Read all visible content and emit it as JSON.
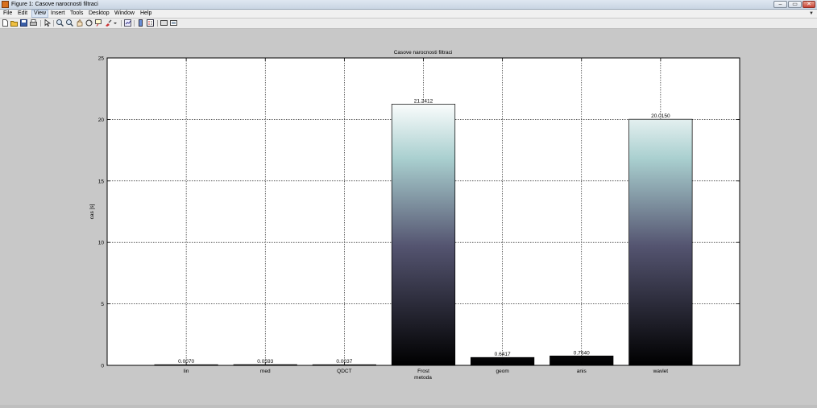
{
  "window": {
    "title": "Figure 1: Casove narocnosti filtraci",
    "controls": {
      "minimize": "–",
      "maximize": "▭",
      "close": "✕"
    }
  },
  "menu": [
    "File",
    "Edit",
    "View",
    "Insert",
    "Tools",
    "Desktop",
    "Window",
    "Help"
  ],
  "menu_active": "View",
  "toolbar": {
    "icons": [
      "new-figure-icon",
      "open-file-icon",
      "save-icon",
      "print-icon",
      "edit-plot-arrow-icon",
      "zoom-in-icon",
      "zoom-out-icon",
      "pan-hand-icon",
      "rotate-3d-icon",
      "data-cursor-icon",
      "brush-icon",
      "brush-dropdown-icon",
      "link-plot-icon",
      "insert-colorbar-icon",
      "insert-legend-icon",
      "hide-plot-tools-icon",
      "show-plot-tools-icon"
    ]
  },
  "chart_data": {
    "type": "bar",
    "title": "Casove narocnosti filtraci",
    "xlabel": "metoda",
    "ylabel": "cas [s]",
    "categories": [
      "lin",
      "med",
      "QDCT",
      "Frost",
      "geom",
      "anis",
      "wavlet"
    ],
    "values": [
      0.007,
      0.0593,
      0.0037,
      21.2412,
      0.6417,
      0.764,
      20.015
    ],
    "value_labels": [
      "0.0070",
      "0.0593",
      "0.0037",
      "21.2412",
      "0.6417",
      "0.7640",
      "20.0150"
    ],
    "ylim": [
      0,
      25
    ],
    "yticks": [
      0,
      5,
      10,
      15,
      20,
      25
    ],
    "grid": true,
    "colormap": "bone",
    "colors": {
      "bar_bottom": "#000000",
      "bar_mid": "#545470",
      "bar_upper": "#a9cfcf",
      "bar_top": "#ffffff",
      "axes_bg": "#ffffff",
      "figure_bg": "#c8c8c8"
    }
  }
}
